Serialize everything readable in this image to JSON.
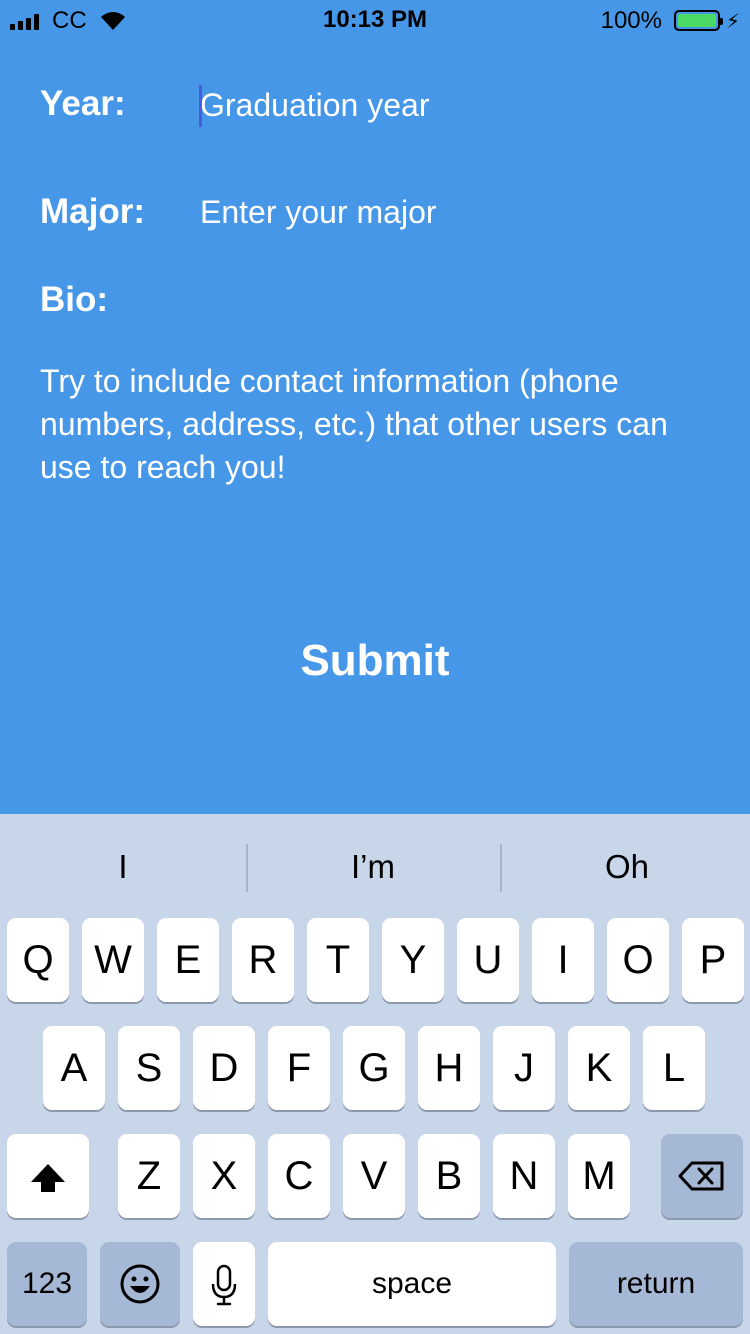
{
  "status_bar": {
    "carrier": "CC",
    "time": "10:13 PM",
    "battery_percent": "100%",
    "battery_level": 1.0,
    "signal_icon": "signal-bars-icon",
    "wifi_icon": "wifi-icon",
    "charging_icon": "bolt-icon"
  },
  "form": {
    "year_label": "Year:",
    "year_placeholder": "Graduation year",
    "major_label": "Major:",
    "major_placeholder": "Enter your major",
    "bio_label": "Bio:",
    "bio_hint": "Try to include contact information (phone numbers, address, etc.) that other users can use to reach you!",
    "submit_label": "Submit"
  },
  "keyboard": {
    "suggestions": [
      "I",
      "I’m",
      "Oh"
    ],
    "row1": [
      "Q",
      "W",
      "E",
      "R",
      "T",
      "Y",
      "U",
      "I",
      "O",
      "P"
    ],
    "row2": [
      "A",
      "S",
      "D",
      "F",
      "G",
      "H",
      "J",
      "K",
      "L"
    ],
    "row3": [
      "Z",
      "X",
      "C",
      "V",
      "B",
      "N",
      "M"
    ],
    "numbers_label": "123",
    "space_label": "space",
    "return_label": "return"
  },
  "colors": {
    "background": "#4797E8",
    "keyboard_bg": "#C8D6EA",
    "battery_fill": "#4CD964"
  }
}
